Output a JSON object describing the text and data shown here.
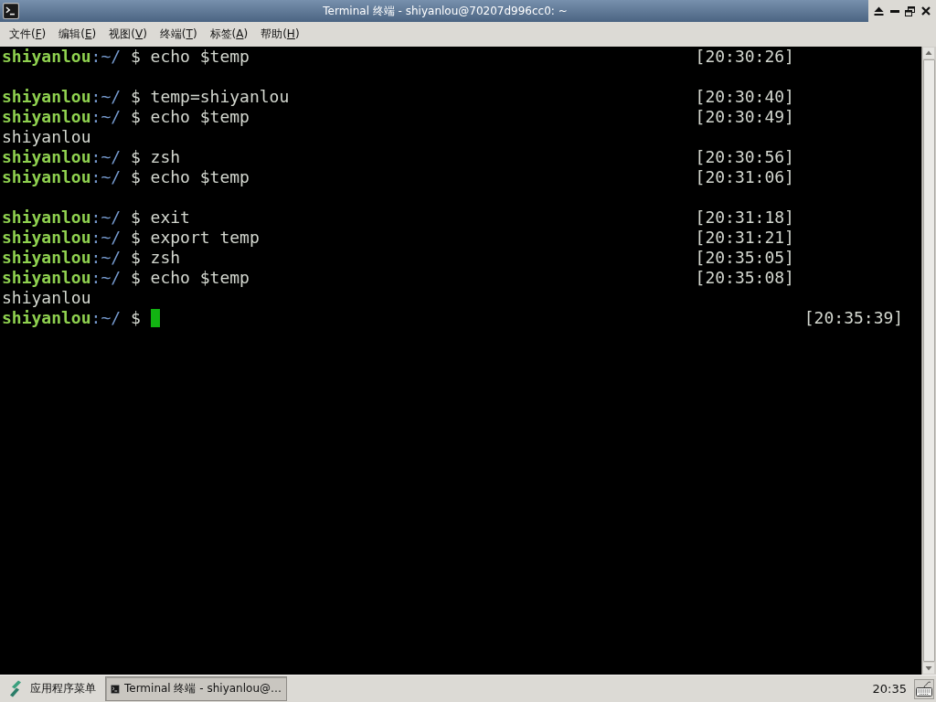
{
  "window": {
    "title": "Terminal 终端 - shiyanlou@70207d996cc0: ~"
  },
  "menu_bar": [
    {
      "label": "文件(F)"
    },
    {
      "label": "编辑(E)"
    },
    {
      "label": "视图(V)"
    },
    {
      "label": "终端(T)"
    },
    {
      "label": "标签(A)"
    },
    {
      "label": "帮助(H)"
    }
  ],
  "terminal": {
    "lines": [
      {
        "kind": "command",
        "user": "shiyanlou",
        "path": ":~/",
        "symbol": "$",
        "command": "echo $temp",
        "time": "[20:30:26]"
      },
      {
        "kind": "blank"
      },
      {
        "kind": "command",
        "user": "shiyanlou",
        "path": ":~/",
        "symbol": "$",
        "command": "temp=shiyanlou",
        "time": "[20:30:40]"
      },
      {
        "kind": "command",
        "user": "shiyanlou",
        "path": ":~/",
        "symbol": "$",
        "command": "echo $temp",
        "time": "[20:30:49]"
      },
      {
        "kind": "output",
        "text": "shiyanlou"
      },
      {
        "kind": "command",
        "user": "shiyanlou",
        "path": ":~/",
        "symbol": "$",
        "command": "zsh",
        "time": "[20:30:56]"
      },
      {
        "kind": "command",
        "user": "shiyanlou",
        "path": ":~/",
        "symbol": "$",
        "command": "echo $temp",
        "time": "[20:31:06]"
      },
      {
        "kind": "blank"
      },
      {
        "kind": "command",
        "user": "shiyanlou",
        "path": ":~/",
        "symbol": "$",
        "command": "exit",
        "time": "[20:31:18]"
      },
      {
        "kind": "command",
        "user": "shiyanlou",
        "path": ":~/",
        "symbol": "$",
        "command": "export temp",
        "time": "[20:31:21]"
      },
      {
        "kind": "command",
        "user": "shiyanlou",
        "path": ":~/",
        "symbol": "$",
        "command": "zsh",
        "time": "[20:35:05]"
      },
      {
        "kind": "command",
        "user": "shiyanlou",
        "path": ":~/",
        "symbol": "$",
        "command": "echo $temp",
        "time": "[20:35:08]"
      },
      {
        "kind": "output",
        "text": "shiyanlou"
      },
      {
        "kind": "current",
        "user": "shiyanlou",
        "path": ":~/",
        "symbol": "$",
        "time": "[20:35:39]"
      }
    ]
  },
  "taskbar": {
    "app_menu": {
      "label": "应用程序菜单"
    },
    "tasks": [
      {
        "label": "Terminal 终端 - shiyanlou@…",
        "selected": true
      }
    ],
    "clock": "20:35"
  }
}
